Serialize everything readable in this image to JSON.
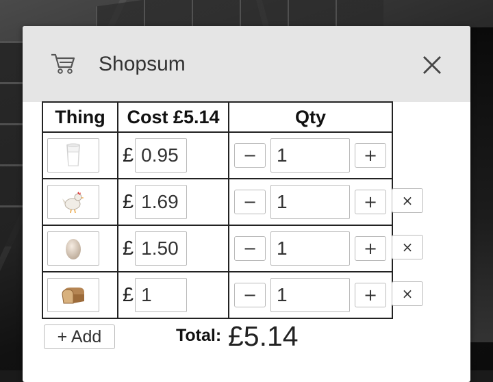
{
  "header": {
    "app_title": "Shopsum",
    "icons": {
      "cart": "cart-icon",
      "close": "close-icon"
    }
  },
  "table": {
    "columns": [
      "Thing",
      "Cost £5.14",
      "Qty"
    ],
    "currency_symbol": "£",
    "minus_label": "−",
    "plus_label": "+",
    "remove_label": "×",
    "rows": [
      {
        "thing_icon": "milk-glass-icon",
        "cost": "0.95",
        "qty": "1",
        "removable": false
      },
      {
        "thing_icon": "chicken-icon",
        "cost": "1.69",
        "qty": "1",
        "removable": true
      },
      {
        "thing_icon": "egg-icon",
        "cost": "1.50",
        "qty": "1",
        "removable": true
      },
      {
        "thing_icon": "bread-icon",
        "cost": "1",
        "qty": "1",
        "removable": true
      }
    ]
  },
  "footer": {
    "add_label": "+ Add",
    "total_label": "Total:",
    "total_value": "£5.14"
  }
}
